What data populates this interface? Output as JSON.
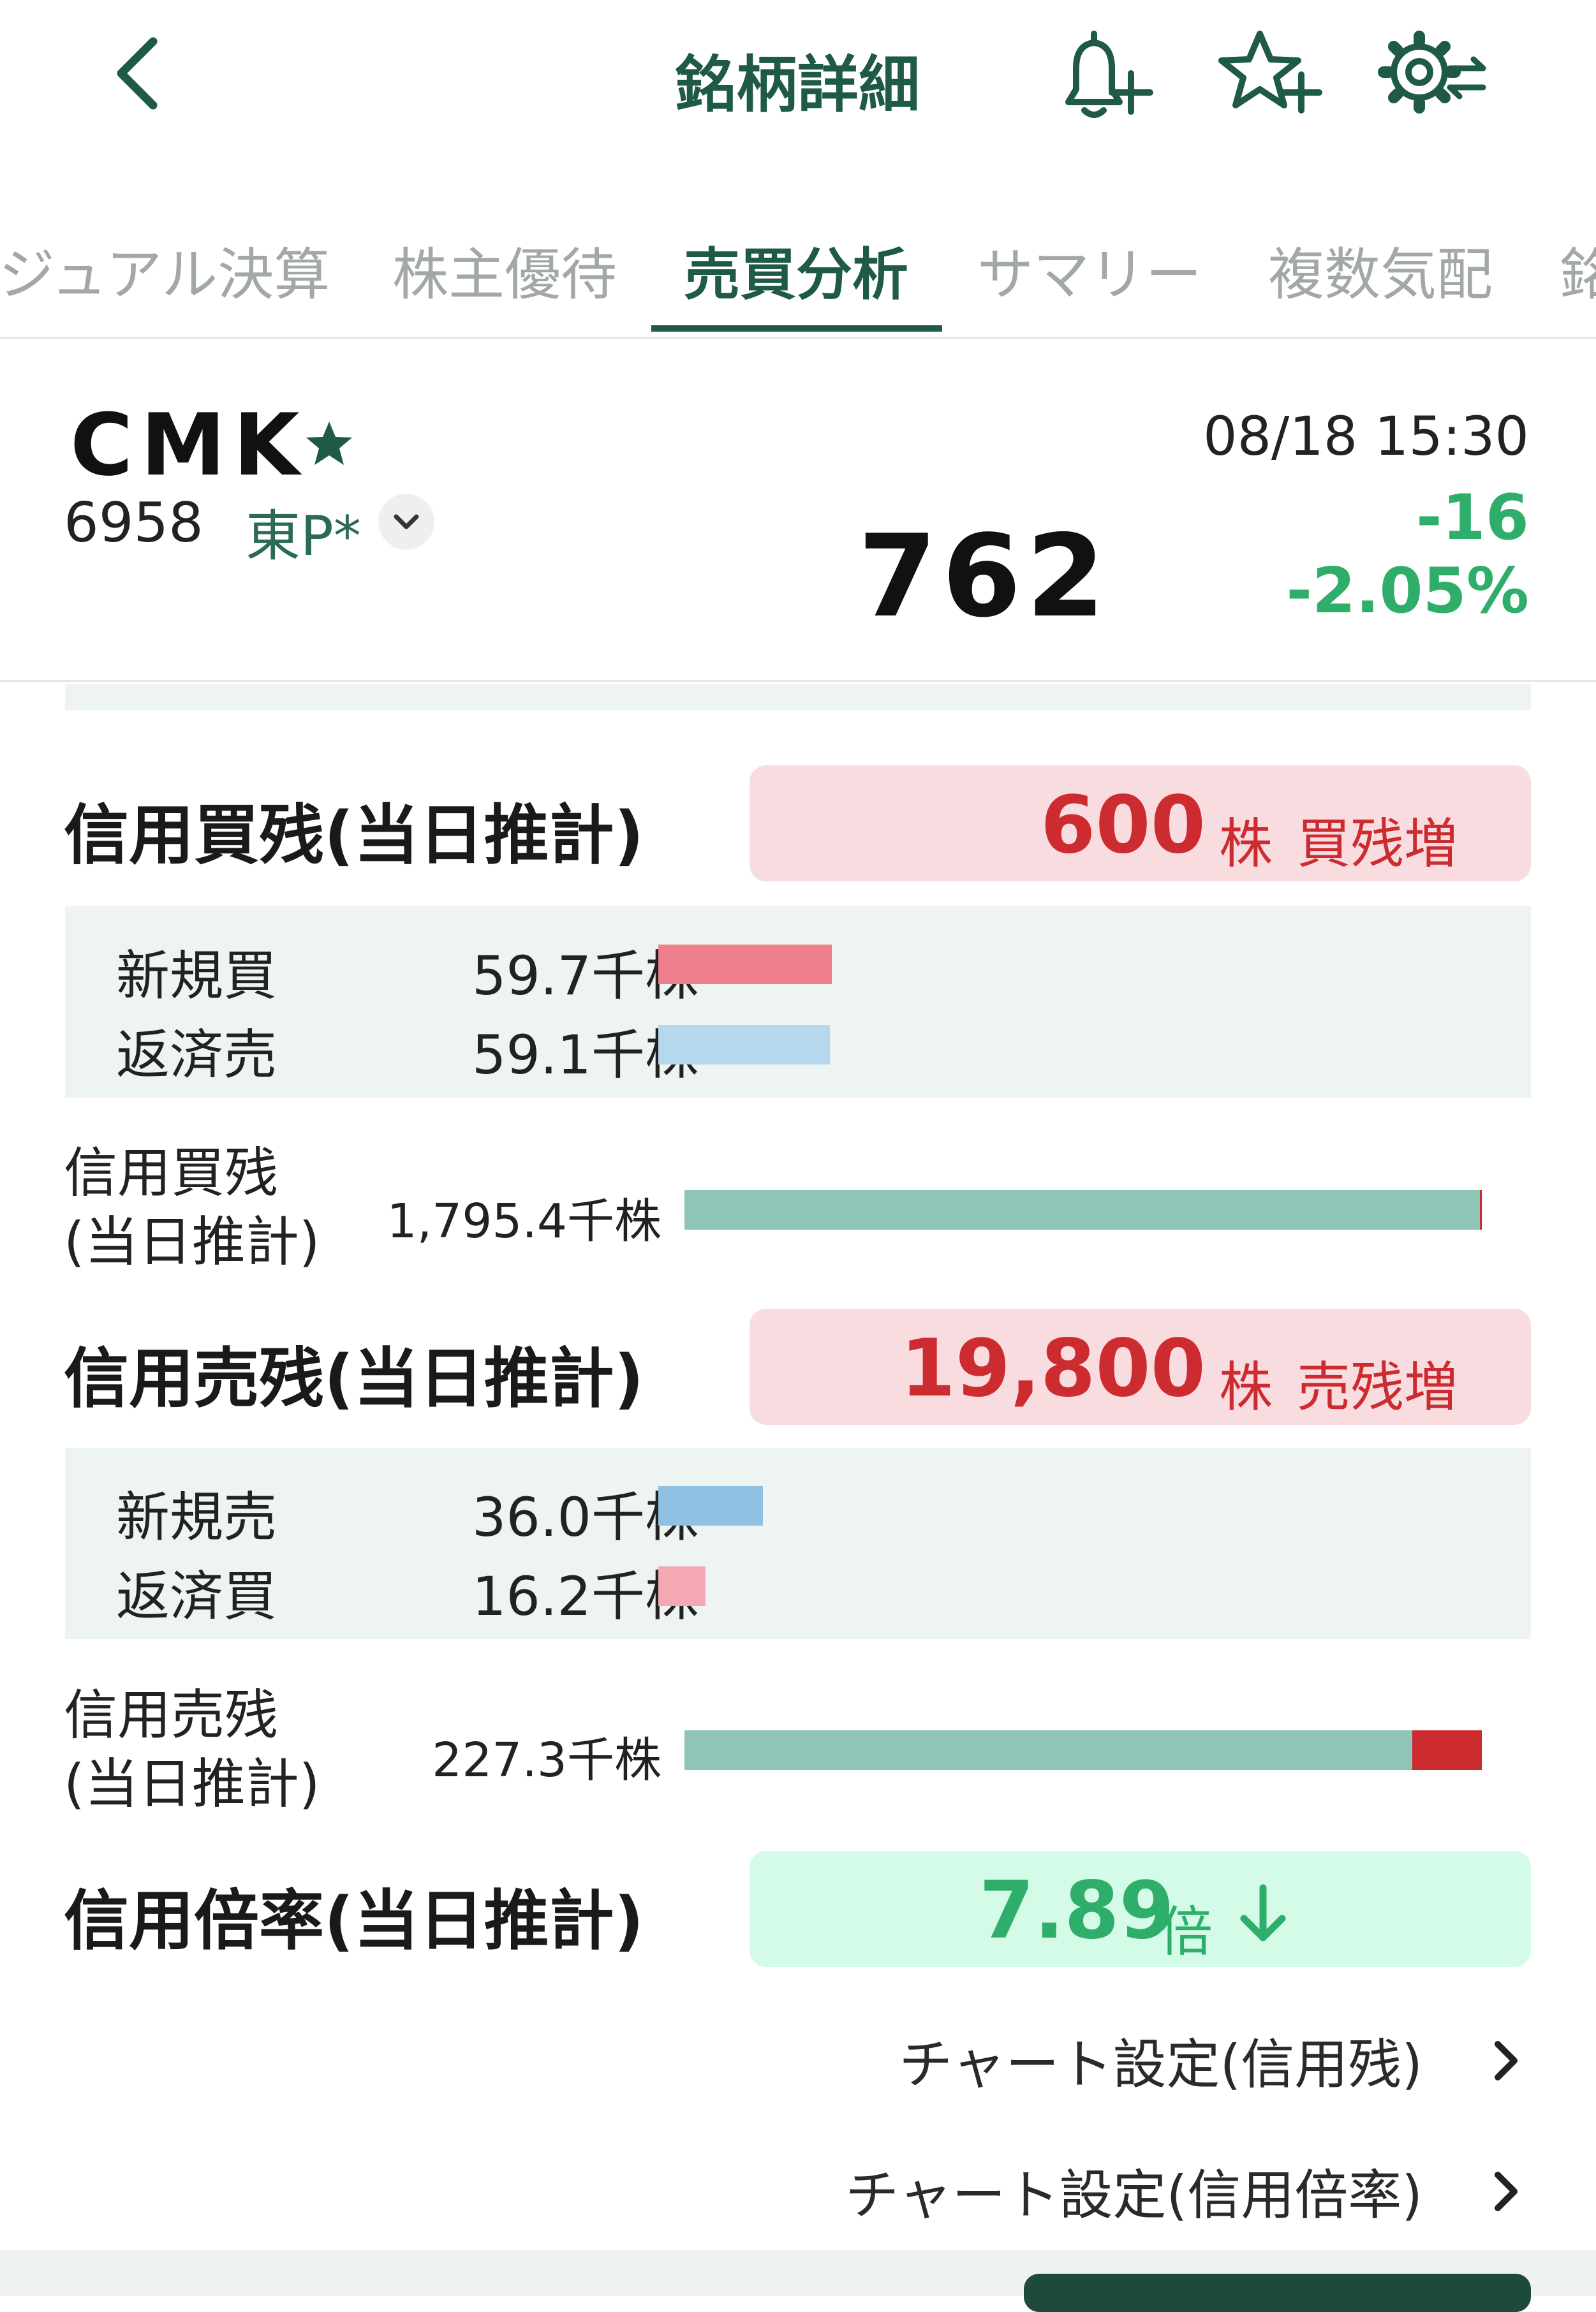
{
  "header": {
    "title": "銘柄詳細"
  },
  "tabs": [
    {
      "label": "ビジュアル決算"
    },
    {
      "label": "株主優待"
    },
    {
      "label": "売買分析"
    },
    {
      "label": "サマリー"
    },
    {
      "label": "複数気配"
    },
    {
      "label": "銘柄"
    }
  ],
  "stock": {
    "name": "CMK",
    "code": "6958",
    "market": "東P*",
    "timestamp": "08/18 15:30",
    "price": "762",
    "change": "-16",
    "change_pct": "-2.05%"
  },
  "buy_margin": {
    "title": "信用買残(当日推計)",
    "badge_value": "600",
    "badge_unit": "株",
    "badge_label": "買残増",
    "rows": [
      {
        "label": "新規買",
        "value": "59.7千株",
        "amount": 59.7
      },
      {
        "label": "返済売",
        "value": "59.1千株",
        "amount": 59.1
      }
    ],
    "balance_label_1": "信用買残",
    "balance_label_2": "(当日推計)",
    "balance_value": "1,795.4千株",
    "balance_amount": 1795.4,
    "balance_increase": 0.6
  },
  "sell_margin": {
    "title": "信用売残(当日推計)",
    "badge_value": "19,800",
    "badge_unit": "株",
    "badge_label": "売残増",
    "rows": [
      {
        "label": "新規売",
        "value": "36.0千株",
        "amount": 36.0
      },
      {
        "label": "返済買",
        "value": "16.2千株",
        "amount": 16.2
      }
    ],
    "balance_label_1": "信用売残",
    "balance_label_2": "(当日推計)",
    "balance_value": "227.3千株",
    "balance_amount": 227.3,
    "balance_increase": 19.8
  },
  "margin_ratio": {
    "title": "信用倍率(当日推計)",
    "value": "7.89",
    "unit": "倍",
    "trend_icon": "arrow-down-icon"
  },
  "links": {
    "chart_setting_balance": "チャート設定(信用残)",
    "chart_setting_ratio": "チャート設定(信用倍率)"
  },
  "colors": {
    "brand_green": "#1e5a47",
    "positive_red": "#cc2c30",
    "negative_green": "#2eae6a",
    "new_buy": "#ef7f8c",
    "close_sell": "#b5d8ef",
    "new_sell": "#8ec1e2",
    "close_buy": "#f3a8b3",
    "balance_bar": "#8fc5b6",
    "increase_bar": "#cc2c30"
  }
}
